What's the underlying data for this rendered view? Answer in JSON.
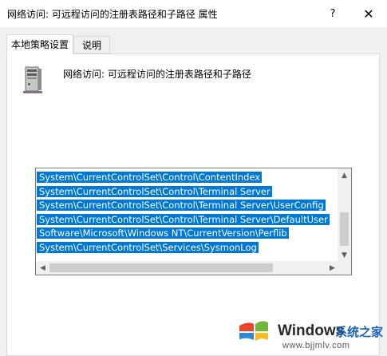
{
  "window": {
    "title": "网络访问: 可远程访问的注册表路径和子路径 属性",
    "help_label": "?",
    "close_label": "✕"
  },
  "tabs": [
    {
      "label": "本地策略设置",
      "active": true
    },
    {
      "label": "说明",
      "active": false
    }
  ],
  "policy": {
    "icon": "server-icon",
    "name": "网络访问: 可远程访问的注册表路径和子路径"
  },
  "registry_paths": [
    "System\\CurrentControlSet\\Control\\ContentIndex",
    "System\\CurrentControlSet\\Control\\Terminal Server",
    "System\\CurrentControlSet\\Control\\Terminal Server\\UserConfig",
    "System\\CurrentControlSet\\Control\\Terminal Server\\DefaultUser",
    "Software\\Microsoft\\Windows NT\\CurrentVersion\\Perflib",
    "System\\CurrentControlSet\\Services\\SysmonLog"
  ],
  "scrollbar": {
    "up": "▲",
    "down": "▼",
    "left": "◀",
    "right": "▶"
  },
  "watermark": {
    "brand": "Windows",
    "brand_cn": "系统之家",
    "url": "www.bjjmlv.com"
  },
  "colors": {
    "selection": "#0078d7",
    "dialog_bg": "#f0f0f0",
    "watermark_blue": "#1a63b8"
  }
}
